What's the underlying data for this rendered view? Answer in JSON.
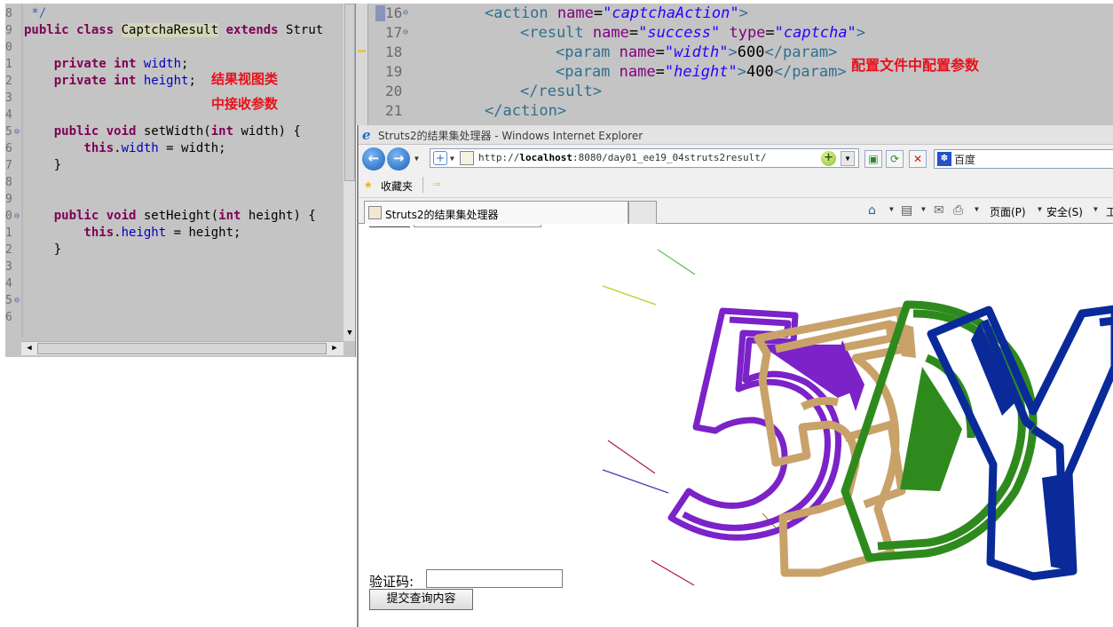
{
  "java_editor": {
    "lines": [
      {
        "num": "8",
        "fold": "",
        "code": [
          {
            "t": " */",
            "c": "cmt"
          }
        ]
      },
      {
        "num": "9",
        "fold": "",
        "code": [
          {
            "t": "public ",
            "c": "kw"
          },
          {
            "t": "class ",
            "c": "kw"
          },
          {
            "t": "CaptchaResult",
            "c": "hl-occ"
          },
          {
            "t": " ",
            "c": ""
          },
          {
            "t": "extends",
            "c": "kw"
          },
          {
            "t": " Strut",
            "c": ""
          }
        ]
      },
      {
        "num": "0",
        "fold": "",
        "code": []
      },
      {
        "num": "1",
        "fold": "",
        "code": [
          {
            "t": "    private ",
            "c": "kw"
          },
          {
            "t": "int ",
            "c": "kw"
          },
          {
            "t": "width",
            "c": "fld"
          },
          {
            "t": ";",
            "c": ""
          }
        ]
      },
      {
        "num": "2",
        "fold": "",
        "code": [
          {
            "t": "    private ",
            "c": "kw"
          },
          {
            "t": "int ",
            "c": "kw"
          },
          {
            "t": "height",
            "c": "fld"
          },
          {
            "t": ";",
            "c": ""
          }
        ]
      },
      {
        "num": "3",
        "fold": "",
        "code": []
      },
      {
        "num": "4",
        "fold": "",
        "code": []
      },
      {
        "num": "5",
        "fold": "⊖",
        "code": [
          {
            "t": "    public ",
            "c": "kw"
          },
          {
            "t": "void ",
            "c": "kw"
          },
          {
            "t": "setWidth(",
            "c": ""
          },
          {
            "t": "int ",
            "c": "kw"
          },
          {
            "t": "width) {",
            "c": ""
          }
        ]
      },
      {
        "num": "6",
        "fold": "",
        "code": [
          {
            "t": "        this",
            "c": "kw"
          },
          {
            "t": ".",
            "c": ""
          },
          {
            "t": "width",
            "c": "fld"
          },
          {
            "t": " = width;",
            "c": ""
          }
        ]
      },
      {
        "num": "7",
        "fold": "",
        "code": [
          {
            "t": "    }",
            "c": ""
          }
        ]
      },
      {
        "num": "8",
        "fold": "",
        "code": []
      },
      {
        "num": "9",
        "fold": "",
        "code": []
      },
      {
        "num": "0",
        "fold": "⊖",
        "code": [
          {
            "t": "    public ",
            "c": "kw"
          },
          {
            "t": "void ",
            "c": "kw"
          },
          {
            "t": "setHeight(",
            "c": ""
          },
          {
            "t": "int ",
            "c": "kw"
          },
          {
            "t": "height) {",
            "c": ""
          }
        ]
      },
      {
        "num": "1",
        "fold": "",
        "code": [
          {
            "t": "        this",
            "c": "kw"
          },
          {
            "t": ".",
            "c": ""
          },
          {
            "t": "height",
            "c": "fld"
          },
          {
            "t": " = height;",
            "c": ""
          }
        ]
      },
      {
        "num": "2",
        "fold": "",
        "code": [
          {
            "t": "    }",
            "c": ""
          }
        ]
      },
      {
        "num": "3",
        "fold": "",
        "code": []
      },
      {
        "num": "4",
        "fold": "",
        "code": []
      },
      {
        "num": "5",
        "fold": "⊖",
        "code": []
      },
      {
        "num": "6",
        "fold": "",
        "code": []
      }
    ],
    "note_line1": "结果视图类",
    "note_line2": "中接收参数"
  },
  "xml_editor": {
    "lines": [
      {
        "num": "16",
        "fold": "⊖",
        "indent": 0,
        "code": [
          {
            "t": "<action ",
            "c": "xtag"
          },
          {
            "t": "name",
            "c": "xattr"
          },
          {
            "t": "=",
            "c": ""
          },
          {
            "t": "\"captchaAction\"",
            "c": "xval"
          },
          {
            "t": ">",
            "c": "xtag"
          }
        ]
      },
      {
        "num": "17",
        "fold": "⊖",
        "indent": 1,
        "code": [
          {
            "t": "<result ",
            "c": "xtag"
          },
          {
            "t": "name",
            "c": "xattr"
          },
          {
            "t": "=",
            "c": ""
          },
          {
            "t": "\"success\"",
            "c": "xval"
          },
          {
            "t": " ",
            "c": ""
          },
          {
            "t": "type",
            "c": "xattr"
          },
          {
            "t": "=",
            "c": ""
          },
          {
            "t": "\"captcha\"",
            "c": "xval"
          },
          {
            "t": ">",
            "c": "xtag"
          }
        ]
      },
      {
        "num": "18",
        "fold": "",
        "indent": 2,
        "code": [
          {
            "t": "<param ",
            "c": "xtag"
          },
          {
            "t": "name",
            "c": "xattr"
          },
          {
            "t": "=",
            "c": ""
          },
          {
            "t": "\"width\"",
            "c": "xval"
          },
          {
            "t": ">",
            "c": "xtag"
          },
          {
            "t": "600",
            "c": ""
          },
          {
            "t": "</param>",
            "c": "xtag"
          }
        ]
      },
      {
        "num": "19",
        "fold": "",
        "indent": 2,
        "code": [
          {
            "t": "<param ",
            "c": "xtag"
          },
          {
            "t": "name",
            "c": "xattr"
          },
          {
            "t": "=",
            "c": ""
          },
          {
            "t": "\"height\"",
            "c": "xval"
          },
          {
            "t": ">",
            "c": "xtag"
          },
          {
            "t": "400",
            "c": ""
          },
          {
            "t": "</param>",
            "c": "xtag"
          }
        ]
      },
      {
        "num": "20",
        "fold": "",
        "indent": 1,
        "code": [
          {
            "t": "</result>",
            "c": "xtag"
          }
        ]
      },
      {
        "num": "21",
        "fold": "",
        "indent": 0,
        "code": [
          {
            "t": "</action>",
            "c": "xtag"
          }
        ]
      }
    ],
    "note": "配置文件中配置参数"
  },
  "ie": {
    "title": "Struts2的结果集处理器 - Windows Internet Explorer",
    "url_prefix": "http://",
    "url_host": "localhost",
    "url_rest": ":8080/day01_ee19_04struts2result/",
    "search_text": "百度",
    "favorites_label": "收藏夹",
    "tab_label": "Struts2的结果集处理器",
    "cmd_page": "页面(P)",
    "cmd_safety": "安全(S)",
    "cmd_tools": "工",
    "captcha_label": "验证码:",
    "captcha_value": "",
    "submit_label": "提交查询内容",
    "captcha_text": "5DY",
    "colors": {
      "purple": "#7b22c8",
      "tan": "#c9a26a",
      "green": "#2f8a1e",
      "navy": "#0a2a9a"
    }
  }
}
